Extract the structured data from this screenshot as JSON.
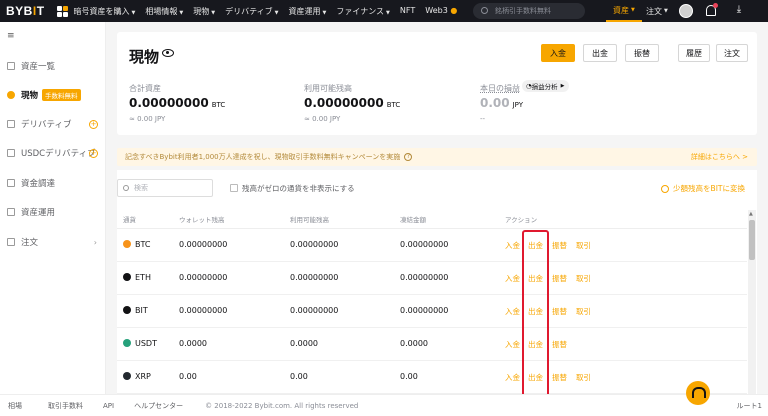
{
  "brand": {
    "logo_left": "BYB",
    "logo_i": "I",
    "logo_right": "T"
  },
  "nav": [
    "暗号資産を購入",
    "相場情報",
    "現物",
    "デリバティブ",
    "資産運用",
    "ファイナンス",
    "NFT",
    "Web3"
  ],
  "search_placeholder": "銘柄引手数料無料",
  "top_right": {
    "assets": "資産",
    "orders": "注文"
  },
  "sidebar": {
    "items": [
      {
        "label": "資産一覧"
      },
      {
        "label": "現物",
        "badge": "手数料無料"
      },
      {
        "label": "デリバティブ"
      },
      {
        "label": "USDCデリバティブ"
      },
      {
        "label": "資金調達"
      },
      {
        "label": "資産運用"
      },
      {
        "label": "注文"
      }
    ]
  },
  "header": {
    "title": "現物",
    "buttons": {
      "deposit": "入金",
      "withdraw": "出金",
      "transfer": "振替",
      "history": "履歴",
      "orders": "注文"
    }
  },
  "stats": {
    "total": {
      "label": "合計資産",
      "value": "0.00000000",
      "unit": "BTC",
      "sub": "≈ 0.00 JPY"
    },
    "available": {
      "label": "利用可能残高",
      "value": "0.00000000",
      "unit": "BTC",
      "sub": "≈ 0.00 JPY"
    },
    "pnl": {
      "label": "本日の損益",
      "pill": "損益分析",
      "value": "0.00",
      "unit": "JPY",
      "sub": "--"
    }
  },
  "banner": {
    "text": "記念すべきBybit利用者1,000万人達成を祝し、現物取引手数料無料キャンペーンを実施",
    "link": "詳細はこちらへ >"
  },
  "filters": {
    "search_placeholder": "検索",
    "hide_zero": "残高がゼロの通貨を非表示にする",
    "convert": "少額残高をBITに変換"
  },
  "table": {
    "headers": [
      "通貨",
      "ウォレット残高",
      "利用可能残高",
      "凍結金額",
      "アクション"
    ],
    "rows": [
      {
        "coin": "BTC",
        "wallet": "0.00000000",
        "available": "0.00000000",
        "frozen": "0.00000000",
        "color": "#f7931a",
        "actions": [
          "入金",
          "出金",
          "振替",
          "取引"
        ]
      },
      {
        "coin": "ETH",
        "wallet": "0.00000000",
        "available": "0.00000000",
        "frozen": "0.00000000",
        "color": "#121214",
        "actions": [
          "入金",
          "出金",
          "振替",
          "取引"
        ]
      },
      {
        "coin": "BIT",
        "wallet": "0.00000000",
        "available": "0.00000000",
        "frozen": "0.00000000",
        "color": "#121214",
        "actions": [
          "入金",
          "出金",
          "振替",
          "取引"
        ]
      },
      {
        "coin": "USDT",
        "wallet": "0.0000",
        "available": "0.0000",
        "frozen": "0.0000",
        "color": "#26a17b",
        "actions": [
          "入金",
          "出金",
          "振替"
        ]
      },
      {
        "coin": "XRP",
        "wallet": "0.00",
        "available": "0.00",
        "frozen": "0.00",
        "color": "#23292f",
        "actions": [
          "入金",
          "出金",
          "振替",
          "取引"
        ]
      }
    ]
  },
  "footer": {
    "links": [
      "相場",
      "取引手数料",
      "API",
      "ヘルプセンター"
    ],
    "copyright": "© 2018-2022 Bybit.com. All rights reserved",
    "route": "ルート1"
  }
}
